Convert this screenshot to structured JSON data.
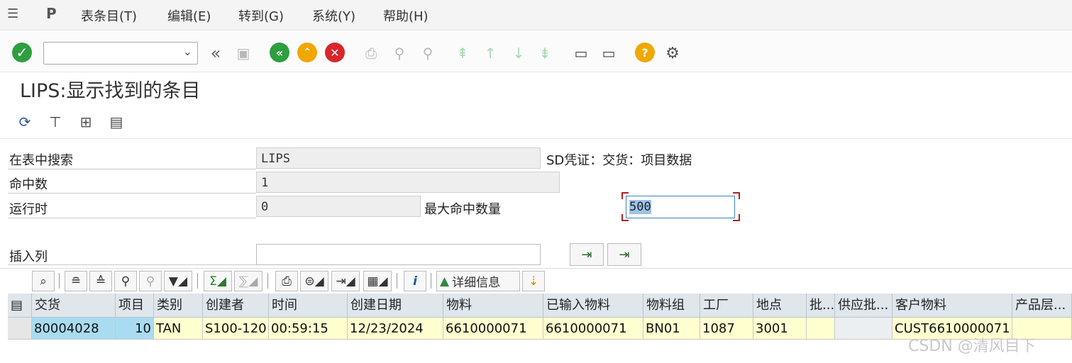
{
  "menu": {
    "items": [
      "表条目(T)",
      "编辑(E)",
      "转到(G)",
      "系统(Y)",
      "帮助(H)"
    ]
  },
  "toolbar": {
    "command_value": "",
    "icons": [
      "enter-icon",
      "back-double-icon",
      "save-icon",
      "back-icon",
      "exit-icon",
      "cancel-icon",
      "print-icon",
      "find-icon",
      "find-next-icon",
      "first-page-icon",
      "prev-page-icon",
      "next-page-icon",
      "last-page-icon",
      "create-session-icon",
      "shortcut-icon",
      "help-icon",
      "settings-icon"
    ]
  },
  "title": "LIPS:显示找到的条目",
  "form": {
    "search_label": "在表中搜索",
    "search_value": "LIPS",
    "table_desc": "SD凭证：交货：项目数据",
    "hits_label": "命中数",
    "hits_value": "1",
    "runtime_label": "运行时",
    "runtime_value": "0",
    "maxhits_label": "最大命中数量",
    "maxhits_value": "500",
    "insert_col_label": "插入列",
    "insert_col_value": ""
  },
  "alv": {
    "detail_label": "详细信息"
  },
  "table": {
    "columns": [
      "交货",
      "项目",
      "类别",
      "创建者",
      "时间",
      "创建日期",
      "物料",
      "已输入物料",
      "物料组",
      "工厂",
      "地点",
      "批...",
      "供应批...",
      "客户物料",
      "产品层..."
    ],
    "rows": [
      [
        "80004028",
        "10",
        "TAN",
        "S100-120",
        "00:59:15",
        "12/23/2024",
        "6610000071",
        "6610000071",
        "BN01",
        "1087",
        "3001",
        "",
        "",
        "CUST6610000071",
        ""
      ]
    ]
  },
  "watermark": "CSDN @清风目下"
}
